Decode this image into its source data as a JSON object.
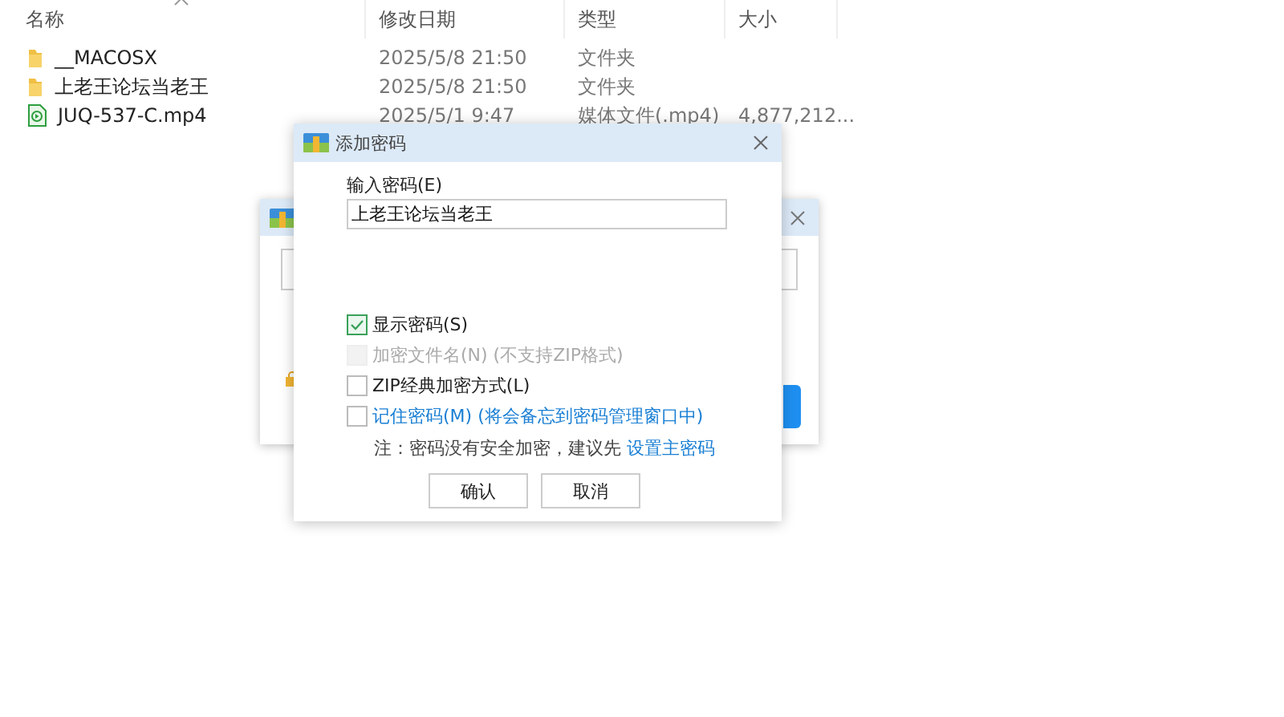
{
  "explorer": {
    "columns": [
      {
        "label": "名称",
        "sorted": true
      },
      {
        "label": "修改日期",
        "sorted": false
      },
      {
        "label": "类型",
        "sorted": false
      },
      {
        "label": "大小",
        "sorted": false
      }
    ],
    "rows": [
      {
        "kind": "folder",
        "name": "__MACOSX",
        "date": "2025/5/8 21:50",
        "type": "文件夹"
      },
      {
        "kind": "folder",
        "name": "上老王论坛当老王",
        "date": "2025/5/8 21:50",
        "type": "文件夹"
      },
      {
        "kind": "video",
        "name": "JUQ-537-C.mp4",
        "date": "2025/5/1 9:47",
        "type": "媒体文件(.mp4)",
        "size": "4,877,212..."
      }
    ]
  },
  "password_dialog": {
    "title": "添加密码",
    "field_label": "输入密码(E)",
    "password": "上老王论坛当老王",
    "options": [
      {
        "kind": "checkbox",
        "label": "显示密码(S)",
        "checked": true,
        "disabled": false
      },
      {
        "kind": "checkbox",
        "label": "加密文件名(N) (不支持ZIP格式)",
        "checked": false,
        "disabled": true
      },
      {
        "kind": "checkbox",
        "label": "ZIP经典加密方式(L)",
        "checked": false,
        "disabled": false
      },
      {
        "kind": "link",
        "label": "记住密码(M) (将会备忘到密码管理窗口中)",
        "checked": false,
        "disabled": false
      }
    ],
    "note": "注：密码没有安全加密，建议先",
    "note_link": "设置主密码",
    "buttons": [
      "确认",
      "取消"
    ]
  }
}
